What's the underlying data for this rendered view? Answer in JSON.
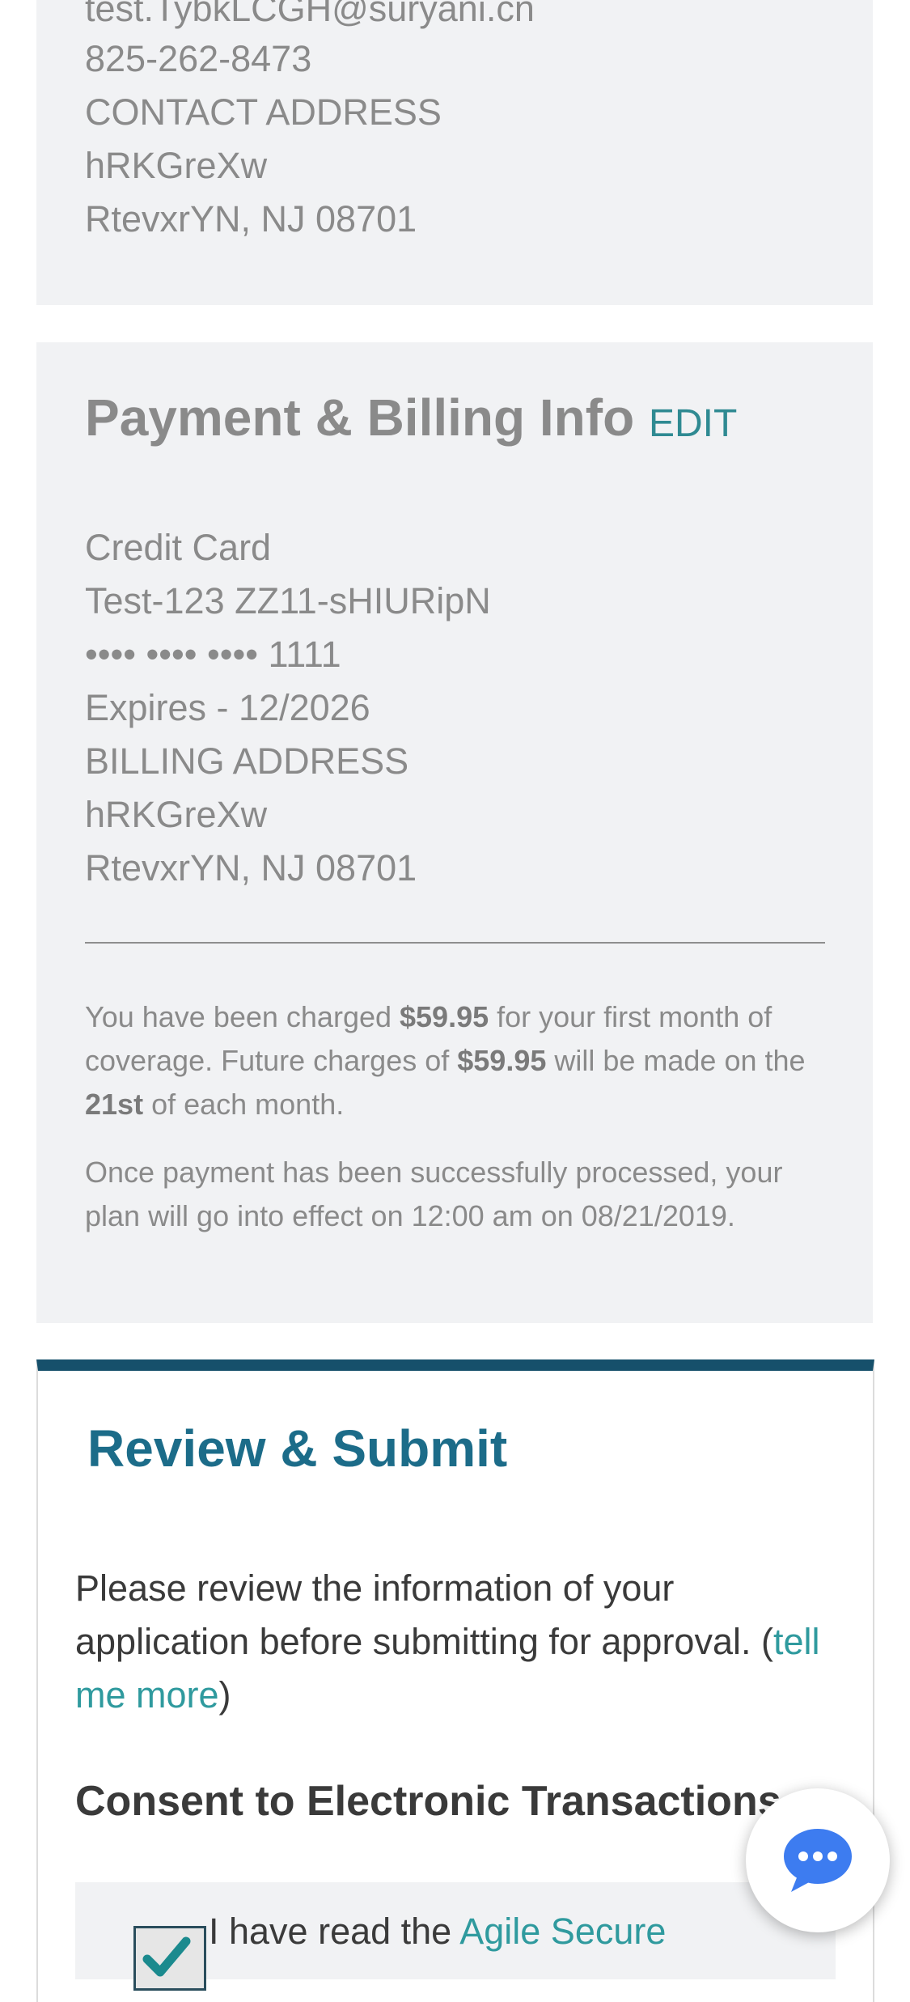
{
  "contact": {
    "email": "test.TybkLCGH@suryani.cn",
    "phone": "825-262-8473",
    "address_heading": "CONTACT ADDRESS",
    "address_line1": "hRKGreXw",
    "address_line2": "RtevxrYN, NJ 08701"
  },
  "payment": {
    "title": "Payment & Billing Info",
    "edit_label": "EDIT",
    "method": "Credit Card",
    "card_name": "Test-123 ZZ11-sHIURipN",
    "card_number": "•••• •••• •••• 1111",
    "expires": "Expires - 12/2026",
    "billing_heading": "BILLING ADDRESS",
    "billing_line1": "hRKGreXw",
    "billing_line2": "RtevxrYN, NJ 08701",
    "charge_pre": "You have been charged ",
    "charge_amount": "$59.95",
    "charge_mid": " for your first month of coverage. Future charges of ",
    "future_amount": "$59.95",
    "charge_mid2": " will be made on the ",
    "charge_day": "21st",
    "charge_post": " of each month.",
    "effective_text": "Once payment has been successfully processed, your plan will go into effect on 12:00 am on 08/21/2019."
  },
  "review": {
    "title": "Review & Submit",
    "text_pre": "Please review the information of your application before submitting for approval. (",
    "link": "tell me more",
    "text_post": ")",
    "consent_title": "Consent to Electronic Transactions",
    "consent_text_pre": "I have read the ",
    "consent_link": "Agile Secure",
    "consent_checked": true
  },
  "icons": {
    "chat": "chat-bubble-icon",
    "check": "checkmark-icon"
  },
  "colors": {
    "accent": "#2f8a92",
    "review_title": "#1c6c89",
    "header_bar": "#16506b",
    "chat_blue": "#3d7cf0"
  }
}
